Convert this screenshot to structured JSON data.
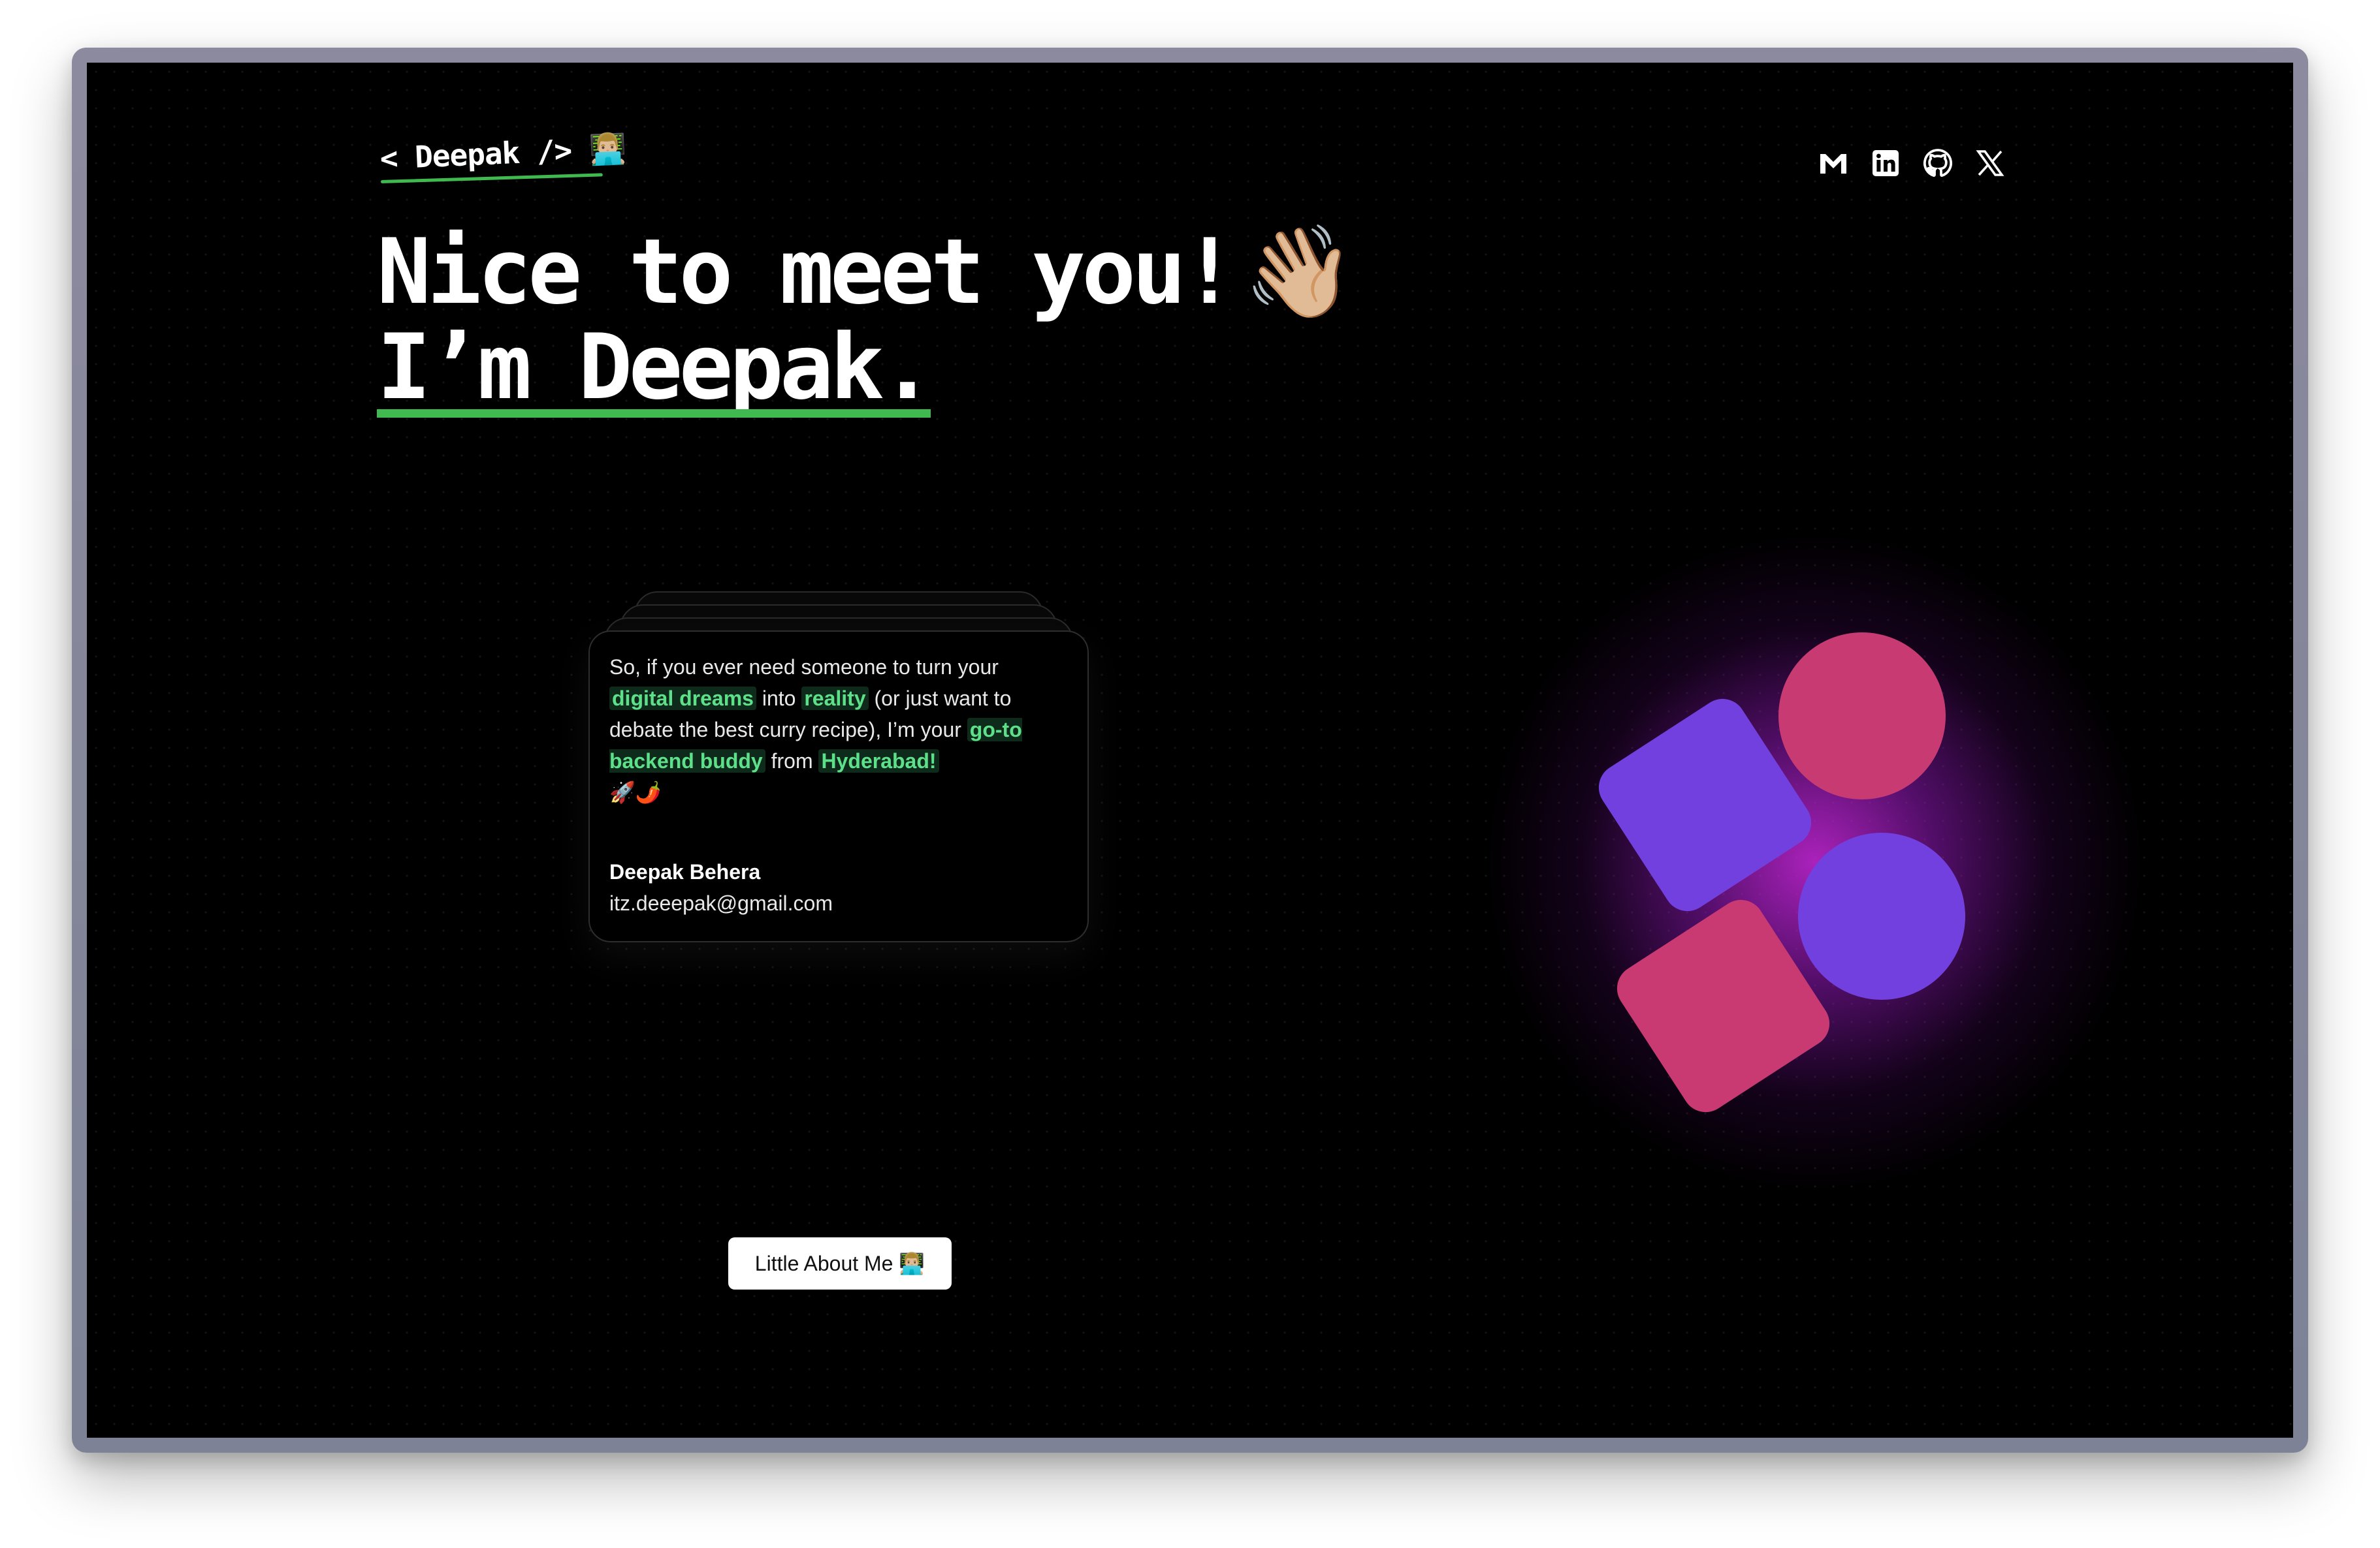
{
  "header": {
    "logo": "< Deepak /> 👨🏼‍💻",
    "social": [
      {
        "name": "gmail-icon",
        "label": "Gmail"
      },
      {
        "name": "linkedin-icon",
        "label": "LinkedIn"
      },
      {
        "name": "github-icon",
        "label": "GitHub"
      },
      {
        "name": "x-icon",
        "label": "X"
      }
    ]
  },
  "hero": {
    "line1": "Nice to meet you!",
    "wave": "👋🏼",
    "line2": "I’m Deepak."
  },
  "card": {
    "p1": "So, if you ever need someone to turn your ",
    "h1": "digital dreams",
    "p2": " into ",
    "h2": "reality",
    "p3": " (or just want to debate the best curry recipe), I’m your ",
    "h3": "go-to backend buddy",
    "p4": " from ",
    "h4": "Hyderabad!",
    "emojis": "🚀🌶️",
    "signature_name": "Deepak Behera",
    "signature_email": "itz.deeepak@gmail.com"
  },
  "button": {
    "label": "Little About Me 👨🏼‍💻"
  },
  "colors": {
    "accent_green": "#3fb950",
    "highlight_green": "#5ee08a",
    "purple": "#7340e0",
    "pink": "#ca3a72"
  }
}
